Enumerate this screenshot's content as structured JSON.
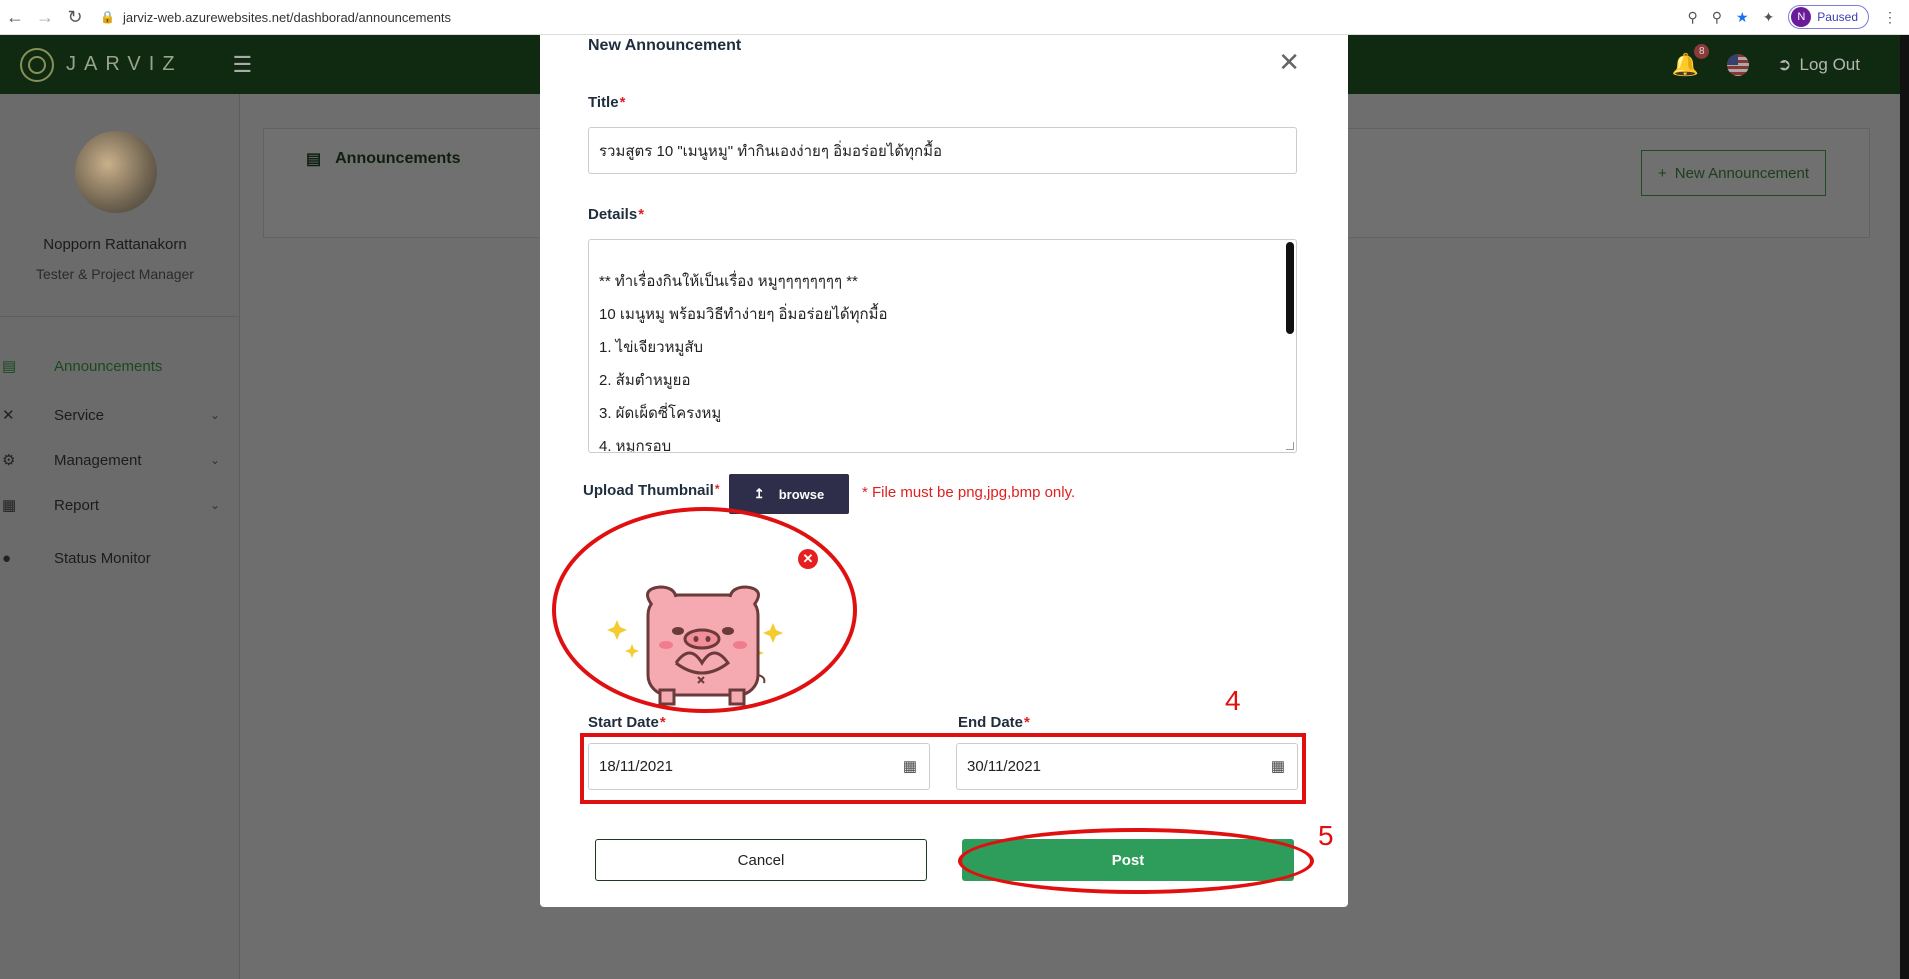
{
  "browser": {
    "url": "jarviz-web.azurewebsites.net/dashborad/announcements",
    "profile_initial": "N",
    "profile_status": "Paused"
  },
  "header": {
    "logo_text": "JARVIZ",
    "notification_count": "8",
    "logout_label": "Log Out"
  },
  "user": {
    "name": "Nopporn Rattanakorn",
    "role": "Tester & Project Manager"
  },
  "sidebar": {
    "items": [
      {
        "label": "Announcements",
        "icon": "list-icon"
      },
      {
        "label": "Service",
        "icon": "tools-icon"
      },
      {
        "label": "Management",
        "icon": "gear-icon"
      },
      {
        "label": "Report",
        "icon": "report-icon"
      },
      {
        "label": "Status Monitor",
        "icon": "location-pin-icon"
      }
    ]
  },
  "page": {
    "title": "Announcements",
    "new_button": "New Announcement"
  },
  "modal": {
    "title": "New Announcement",
    "title_label": "Title",
    "title_value": "รวมสูตร 10 \"เมนูหมู\" ทำกินเองง่ายๆ อิ่มอร่อยได้ทุกมื้อ",
    "details_label": "Details",
    "details_lines": [
      "** ทำเรื่องกินให้เป็นเรื่อง หมูๆๆๆๆๆๆๆๆ **",
      "10 เมนูหมู พร้อมวิธีทำง่ายๆ อิ่มอร่อยได้ทุกมื้อ",
      "1. ไข่เจียวหมูสับ",
      "2. ส้มตำหมูยอ",
      "3. ผัดเผ็ดซี่โครงหมู",
      "4. หมูกรอบ"
    ],
    "upload_label": "Upload Thumbnail",
    "browse_label": "browse",
    "file_note": "* File must be png,jpg,bmp only.",
    "start_label": "Start Date",
    "start_value": "18/11/2021",
    "end_label": "End Date",
    "end_value": "30/11/2021",
    "cancel_label": "Cancel",
    "post_label": "Post"
  },
  "annotations": {
    "step_dates": "4",
    "step_post": "5"
  },
  "colors": {
    "primary_green": "#2e9c5a",
    "required_red": "#e02020",
    "annotation_red": "#e01010"
  }
}
